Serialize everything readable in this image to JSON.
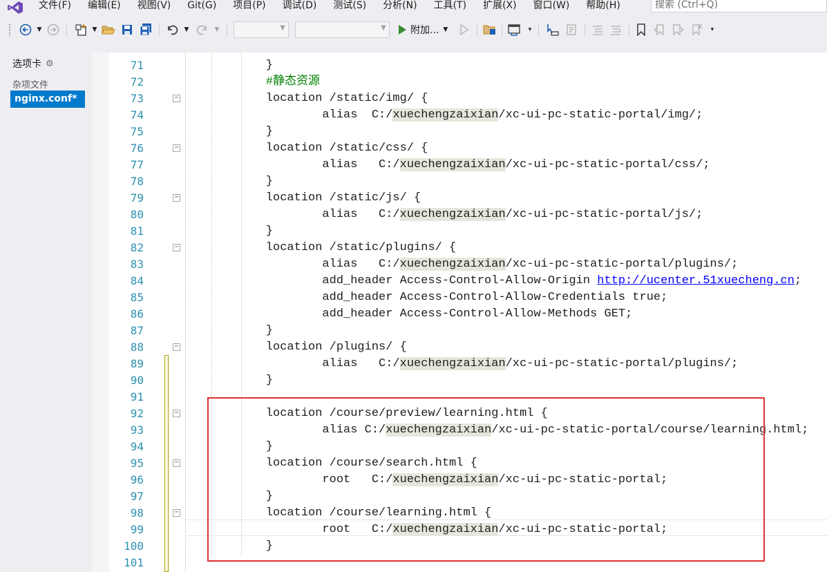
{
  "menu": {
    "items": [
      "文件(F)",
      "编辑(E)",
      "视图(V)",
      "Git(G)",
      "项目(P)",
      "调试(D)",
      "测试(S)",
      "分析(N)",
      "工具(T)",
      "扩展(X)",
      "窗口(W)",
      "帮助(H)"
    ],
    "search_placeholder": "搜索 (Ctrl+Q)"
  },
  "toolbar": {
    "run_label": "附加...",
    "icons": [
      "back-icon",
      "forward-icon",
      "new-project-icon",
      "open-folder-icon",
      "save-icon",
      "save-all-icon",
      "undo-icon",
      "redo-icon",
      "run-icon",
      "run-without-debug-icon",
      "solution-explorer-icon",
      "window-layout-icon",
      "step-icon",
      "format-icon",
      "comment-icon",
      "uncomment-icon",
      "bookmark-icon",
      "prev-bookmark-icon",
      "next-bookmark-icon",
      "clear-bookmarks-icon"
    ]
  },
  "tabs_panel": {
    "header": "选项卡",
    "group_label": "杂项文件",
    "active_tab": "nginx.conf*"
  },
  "editor": {
    "lines": [
      {
        "n": "71",
        "segs": [
          {
            "t": "    }"
          }
        ]
      },
      {
        "n": "72",
        "segs": [
          {
            "t": "    "
          },
          {
            "t": "#静态资源",
            "c": "cmt"
          }
        ]
      },
      {
        "n": "73",
        "segs": [
          {
            "t": "    location /static/img/ {"
          }
        ]
      },
      {
        "n": "74",
        "segs": [
          {
            "t": "            alias  C:/"
          },
          {
            "t": "xuechengzaixian",
            "c": "hl"
          },
          {
            "t": "/xc-ui-pc-static-portal/img/;"
          }
        ]
      },
      {
        "n": "75",
        "segs": [
          {
            "t": "    }"
          }
        ]
      },
      {
        "n": "76",
        "segs": [
          {
            "t": "    location /static/css/ {"
          }
        ]
      },
      {
        "n": "77",
        "segs": [
          {
            "t": "            alias   C:/"
          },
          {
            "t": "xuechengzaixian",
            "c": "hl"
          },
          {
            "t": "/xc-ui-pc-static-portal/css/;"
          }
        ]
      },
      {
        "n": "78",
        "segs": [
          {
            "t": "    }"
          }
        ]
      },
      {
        "n": "79",
        "segs": [
          {
            "t": "    location /static/js/ {"
          }
        ]
      },
      {
        "n": "80",
        "segs": [
          {
            "t": "            alias   C:/"
          },
          {
            "t": "xuechengzaixian",
            "c": "hl"
          },
          {
            "t": "/xc-ui-pc-static-portal/js/;"
          }
        ]
      },
      {
        "n": "81",
        "segs": [
          {
            "t": "    }"
          }
        ]
      },
      {
        "n": "82",
        "segs": [
          {
            "t": "    location /static/plugins/ {"
          }
        ]
      },
      {
        "n": "83",
        "segs": [
          {
            "t": "            alias   C:/"
          },
          {
            "t": "xuechengzaixian",
            "c": "hl"
          },
          {
            "t": "/xc-ui-pc-static-portal/plugins/;"
          }
        ]
      },
      {
        "n": "84",
        "segs": [
          {
            "t": "            add_header Access-Control-Allow-Origin "
          },
          {
            "t": "http://ucenter.51xuecheng.cn",
            "c": "lnk"
          },
          {
            "t": ";"
          }
        ]
      },
      {
        "n": "85",
        "segs": [
          {
            "t": "            add_header Access-Control-Allow-Credentials true;"
          }
        ]
      },
      {
        "n": "86",
        "segs": [
          {
            "t": "            add_header Access-Control-Allow-Methods GET;"
          }
        ]
      },
      {
        "n": "87",
        "segs": [
          {
            "t": "    }"
          }
        ]
      },
      {
        "n": "88",
        "segs": [
          {
            "t": "    location /plugins/ {"
          }
        ]
      },
      {
        "n": "89",
        "segs": [
          {
            "t": "            alias   C:/"
          },
          {
            "t": "xuechengzaixian",
            "c": "hl"
          },
          {
            "t": "/xc-ui-pc-static-portal/plugins/;"
          }
        ]
      },
      {
        "n": "90",
        "segs": [
          {
            "t": "    }"
          }
        ]
      },
      {
        "n": "91",
        "segs": [
          {
            "t": ""
          }
        ]
      },
      {
        "n": "92",
        "segs": [
          {
            "t": "    location /course/preview/learning.html {"
          }
        ]
      },
      {
        "n": "93",
        "segs": [
          {
            "t": "            alias C:/"
          },
          {
            "t": "xuechengzaixian",
            "c": "hl"
          },
          {
            "t": "/xc-ui-pc-static-portal/course/learning.html;"
          }
        ]
      },
      {
        "n": "94",
        "segs": [
          {
            "t": "    }"
          }
        ]
      },
      {
        "n": "95",
        "segs": [
          {
            "t": "    location /course/search.html {"
          }
        ]
      },
      {
        "n": "96",
        "segs": [
          {
            "t": "            root   C:/"
          },
          {
            "t": "xuechengzaixian",
            "c": "hl"
          },
          {
            "t": "/xc-ui-pc-static-portal;"
          }
        ]
      },
      {
        "n": "97",
        "segs": [
          {
            "t": "    }"
          }
        ]
      },
      {
        "n": "98",
        "segs": [
          {
            "t": "    location /course/learning.html {"
          }
        ]
      },
      {
        "n": "99",
        "segs": [
          {
            "t": "            root   C:/"
          },
          {
            "t": "xuechengzaixian",
            "c": "hl"
          },
          {
            "t": "/xc-ui-pc-static-portal;"
          }
        ]
      },
      {
        "n": "100",
        "segs": [
          {
            "t": "    }"
          }
        ]
      },
      {
        "n": "101",
        "segs": [
          {
            "t": ""
          }
        ]
      }
    ],
    "fold_lines": [
      "73",
      "76",
      "79",
      "82",
      "88",
      "92",
      "95",
      "98"
    ]
  }
}
